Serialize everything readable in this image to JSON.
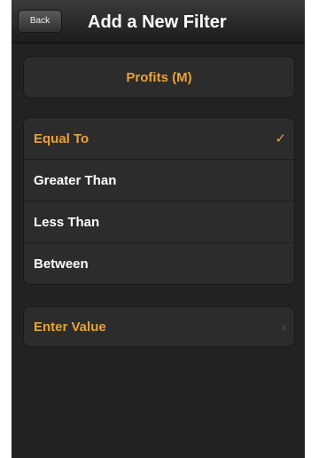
{
  "nav": {
    "back_label": "Back",
    "title": "Add a New Filter"
  },
  "field": {
    "label": "Profits (M)"
  },
  "options": [
    {
      "label": "Equal To",
      "selected": true
    },
    {
      "label": "Greater Than",
      "selected": false
    },
    {
      "label": "Less Than",
      "selected": false
    },
    {
      "label": "Between",
      "selected": false
    }
  ],
  "check_glyph": "✓",
  "value_row": {
    "label": "Enter Value",
    "chevron_glyph": "›"
  },
  "colors": {
    "accent": "#e8a23a",
    "background": "#222222",
    "group": "#2c2c2c"
  },
  "icons": {
    "check": "check-icon",
    "chevron": "chevron-right-icon"
  }
}
